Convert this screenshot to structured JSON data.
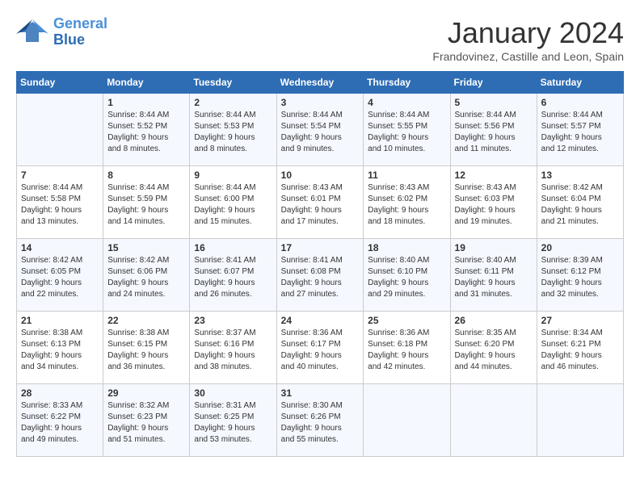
{
  "logo": {
    "line1": "General",
    "line2": "Blue"
  },
  "title": "January 2024",
  "subtitle": "Frandovinez, Castille and Leon, Spain",
  "days_header": [
    "Sunday",
    "Monday",
    "Tuesday",
    "Wednesday",
    "Thursday",
    "Friday",
    "Saturday"
  ],
  "weeks": [
    [
      {
        "day": "",
        "info": ""
      },
      {
        "day": "1",
        "info": "Sunrise: 8:44 AM\nSunset: 5:52 PM\nDaylight: 9 hours\nand 8 minutes."
      },
      {
        "day": "2",
        "info": "Sunrise: 8:44 AM\nSunset: 5:53 PM\nDaylight: 9 hours\nand 8 minutes."
      },
      {
        "day": "3",
        "info": "Sunrise: 8:44 AM\nSunset: 5:54 PM\nDaylight: 9 hours\nand 9 minutes."
      },
      {
        "day": "4",
        "info": "Sunrise: 8:44 AM\nSunset: 5:55 PM\nDaylight: 9 hours\nand 10 minutes."
      },
      {
        "day": "5",
        "info": "Sunrise: 8:44 AM\nSunset: 5:56 PM\nDaylight: 9 hours\nand 11 minutes."
      },
      {
        "day": "6",
        "info": "Sunrise: 8:44 AM\nSunset: 5:57 PM\nDaylight: 9 hours\nand 12 minutes."
      }
    ],
    [
      {
        "day": "7",
        "info": "Sunrise: 8:44 AM\nSunset: 5:58 PM\nDaylight: 9 hours\nand 13 minutes."
      },
      {
        "day": "8",
        "info": "Sunrise: 8:44 AM\nSunset: 5:59 PM\nDaylight: 9 hours\nand 14 minutes."
      },
      {
        "day": "9",
        "info": "Sunrise: 8:44 AM\nSunset: 6:00 PM\nDaylight: 9 hours\nand 15 minutes."
      },
      {
        "day": "10",
        "info": "Sunrise: 8:43 AM\nSunset: 6:01 PM\nDaylight: 9 hours\nand 17 minutes."
      },
      {
        "day": "11",
        "info": "Sunrise: 8:43 AM\nSunset: 6:02 PM\nDaylight: 9 hours\nand 18 minutes."
      },
      {
        "day": "12",
        "info": "Sunrise: 8:43 AM\nSunset: 6:03 PM\nDaylight: 9 hours\nand 19 minutes."
      },
      {
        "day": "13",
        "info": "Sunrise: 8:42 AM\nSunset: 6:04 PM\nDaylight: 9 hours\nand 21 minutes."
      }
    ],
    [
      {
        "day": "14",
        "info": "Sunrise: 8:42 AM\nSunset: 6:05 PM\nDaylight: 9 hours\nand 22 minutes."
      },
      {
        "day": "15",
        "info": "Sunrise: 8:42 AM\nSunset: 6:06 PM\nDaylight: 9 hours\nand 24 minutes."
      },
      {
        "day": "16",
        "info": "Sunrise: 8:41 AM\nSunset: 6:07 PM\nDaylight: 9 hours\nand 26 minutes."
      },
      {
        "day": "17",
        "info": "Sunrise: 8:41 AM\nSunset: 6:08 PM\nDaylight: 9 hours\nand 27 minutes."
      },
      {
        "day": "18",
        "info": "Sunrise: 8:40 AM\nSunset: 6:10 PM\nDaylight: 9 hours\nand 29 minutes."
      },
      {
        "day": "19",
        "info": "Sunrise: 8:40 AM\nSunset: 6:11 PM\nDaylight: 9 hours\nand 31 minutes."
      },
      {
        "day": "20",
        "info": "Sunrise: 8:39 AM\nSunset: 6:12 PM\nDaylight: 9 hours\nand 32 minutes."
      }
    ],
    [
      {
        "day": "21",
        "info": "Sunrise: 8:38 AM\nSunset: 6:13 PM\nDaylight: 9 hours\nand 34 minutes."
      },
      {
        "day": "22",
        "info": "Sunrise: 8:38 AM\nSunset: 6:15 PM\nDaylight: 9 hours\nand 36 minutes."
      },
      {
        "day": "23",
        "info": "Sunrise: 8:37 AM\nSunset: 6:16 PM\nDaylight: 9 hours\nand 38 minutes."
      },
      {
        "day": "24",
        "info": "Sunrise: 8:36 AM\nSunset: 6:17 PM\nDaylight: 9 hours\nand 40 minutes."
      },
      {
        "day": "25",
        "info": "Sunrise: 8:36 AM\nSunset: 6:18 PM\nDaylight: 9 hours\nand 42 minutes."
      },
      {
        "day": "26",
        "info": "Sunrise: 8:35 AM\nSunset: 6:20 PM\nDaylight: 9 hours\nand 44 minutes."
      },
      {
        "day": "27",
        "info": "Sunrise: 8:34 AM\nSunset: 6:21 PM\nDaylight: 9 hours\nand 46 minutes."
      }
    ],
    [
      {
        "day": "28",
        "info": "Sunrise: 8:33 AM\nSunset: 6:22 PM\nDaylight: 9 hours\nand 49 minutes."
      },
      {
        "day": "29",
        "info": "Sunrise: 8:32 AM\nSunset: 6:23 PM\nDaylight: 9 hours\nand 51 minutes."
      },
      {
        "day": "30",
        "info": "Sunrise: 8:31 AM\nSunset: 6:25 PM\nDaylight: 9 hours\nand 53 minutes."
      },
      {
        "day": "31",
        "info": "Sunrise: 8:30 AM\nSunset: 6:26 PM\nDaylight: 9 hours\nand 55 minutes."
      },
      {
        "day": "",
        "info": ""
      },
      {
        "day": "",
        "info": ""
      },
      {
        "day": "",
        "info": ""
      }
    ]
  ]
}
